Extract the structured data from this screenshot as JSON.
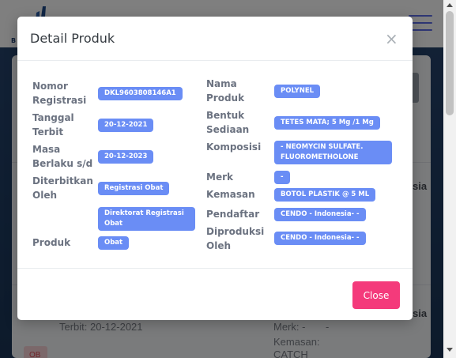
{
  "modal": {
    "title": "Detail Produk",
    "close_x": "×",
    "close_button": "Close"
  },
  "fields": {
    "nomor_registrasi": {
      "label": "Nomor Registrasi",
      "value": "DKL9603808146A1"
    },
    "tanggal_terbit": {
      "label": "Tanggal Terbit",
      "value": "20-12-2021"
    },
    "masa_berlaku": {
      "label": "Masa Berlaku s/d",
      "value": "20-12-2023"
    },
    "diterbitkan_oleh": {
      "label": "Diterbitkan Oleh",
      "value": "Registrasi Obat",
      "value2": "Direktorat Registrasi Obat"
    },
    "produk": {
      "label": "Produk",
      "value": "Obat"
    },
    "nama_produk": {
      "label": "Nama Produk",
      "value": "POLYNEL"
    },
    "bentuk_sediaan": {
      "label": "Bentuk Sediaan",
      "value": "TETES MATA; 5 Mg /1 Mg"
    },
    "komposisi": {
      "label": "Komposisi",
      "value": "- NEOMYCIN SULFATE. FLUOROMETHOLONE"
    },
    "merk": {
      "label": "Merk",
      "value": "-"
    },
    "kemasan": {
      "label": "Kemasan",
      "value": "BOTOL PLASTIK @ 5 ML"
    },
    "pendaftar": {
      "label": "Pendaftar",
      "value": "CENDO - Indonesia- -"
    },
    "diproduksi_oleh": {
      "label": "Diproduksi Oleh",
      "value": "CENDO - Indonesia- -"
    }
  },
  "background": {
    "row1_suffix": "sia",
    "row2_suffix": "sia",
    "terbit_text": "Terbit: 20-12-2021",
    "merk_text": "Merk: -",
    "merk_dash": "-",
    "kemasan_text": "Kemasan:",
    "catch_text": "CATCH",
    "badge_text": "OB"
  },
  "colors": {
    "badge": "#6a8df5",
    "close_button": "#f43a7b",
    "label": "#6b7280",
    "nav_accent": "#5d6de8"
  },
  "icons": {
    "close": "close-icon",
    "menu": "hamburger-menu-icon",
    "logo": "logo-icon"
  }
}
